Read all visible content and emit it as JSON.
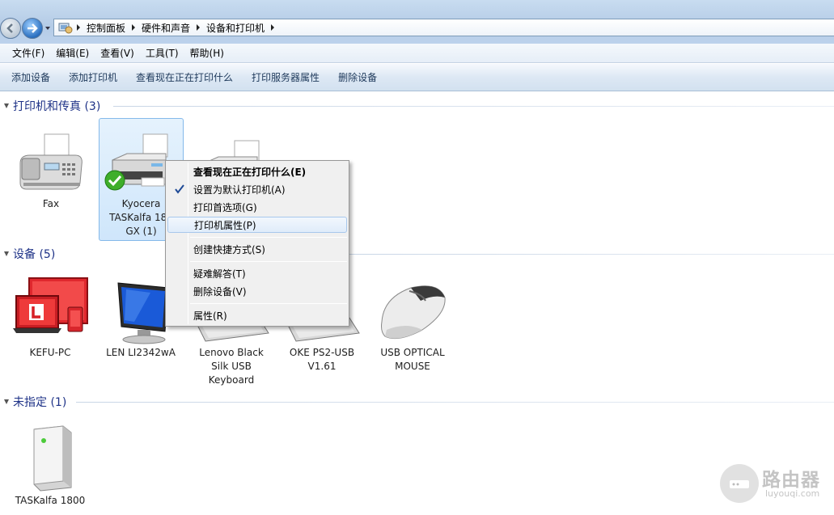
{
  "breadcrumb": {
    "items": [
      "控制面板",
      "硬件和声音",
      "设备和打印机"
    ]
  },
  "menubar": {
    "items": [
      "文件(F)",
      "编辑(E)",
      "查看(V)",
      "工具(T)",
      "帮助(H)"
    ]
  },
  "commandbar": {
    "items": [
      "添加设备",
      "添加打印机",
      "查看现在正在打印什么",
      "打印服务器属性",
      "删除设备"
    ]
  },
  "groups": {
    "printers": {
      "title": "打印机和传真 (3)"
    },
    "devices": {
      "title": "设备 (5)"
    },
    "unspecified": {
      "title": "未指定 (1)"
    }
  },
  "printers": [
    {
      "label": "Fax",
      "icon": "fax-icon"
    },
    {
      "label": "Kyocera\nTASKalfa 180\nGX (1)",
      "icon": "printer-icon",
      "selected": true,
      "default": true
    },
    {
      "label": "",
      "icon": "printer-icon"
    }
  ],
  "devices": [
    {
      "label": "KEFU-PC",
      "icon": "computer-icon"
    },
    {
      "label": "LEN LI2342wA",
      "icon": "monitor-icon"
    },
    {
      "label": "Lenovo Black\nSilk USB\nKeyboard",
      "icon": "keyboard-icon"
    },
    {
      "label": "OKE PS2-USB\nV1.61",
      "icon": "keyboard-icon"
    },
    {
      "label": "USB OPTICAL\nMOUSE",
      "icon": "mouse-icon"
    }
  ],
  "unspecified": [
    {
      "label": "TASKalfa 1800",
      "icon": "tower-device-icon"
    }
  ],
  "context_menu": {
    "items": [
      {
        "label": "查看现在正在打印什么(E)",
        "bold": true
      },
      {
        "label": "设置为默认打印机(A)",
        "checked": true
      },
      {
        "label": "打印首选项(G)"
      },
      {
        "label": "打印机属性(P)",
        "hover": true
      },
      {
        "label": "创建快捷方式(S)"
      },
      {
        "label": "疑难解答(T)"
      },
      {
        "label": "删除设备(V)"
      },
      {
        "label": "属性(R)"
      }
    ]
  },
  "watermark": {
    "text": "路由器",
    "sub": "luyouqi.com"
  },
  "colors": {
    "group_title": "#1e3287",
    "selection": "#cfe6fb",
    "accent": "#2a6fc0"
  }
}
